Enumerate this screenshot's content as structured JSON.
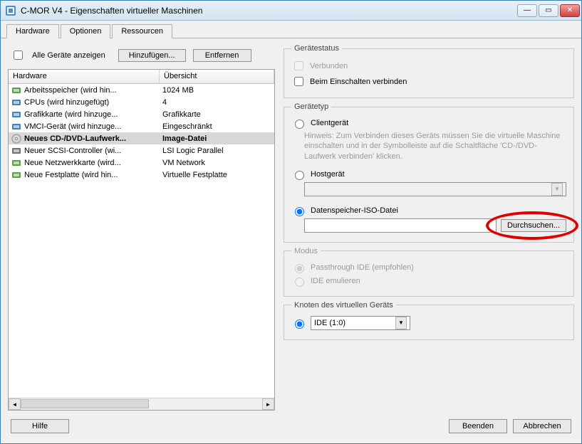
{
  "window": {
    "title": "C-MOR V4 - Eigenschaften virtueller Maschinen"
  },
  "tabs": {
    "hardware": "Hardware",
    "options": "Optionen",
    "resources": "Ressourcen"
  },
  "toprow": {
    "show_all": "Alle Geräte anzeigen",
    "add": "Hinzufügen...",
    "remove": "Entfernen"
  },
  "listhead": {
    "col1": "Hardware",
    "col2": "Übersicht"
  },
  "rows": [
    {
      "name": "Arbeitsspeicher (wird hin...",
      "ov": "1024 MB",
      "icon": "ram"
    },
    {
      "name": "CPUs (wird hinzugefügt)",
      "ov": "4",
      "icon": "cpu"
    },
    {
      "name": "Grafikkarte  (wird hinzuge...",
      "ov": "Grafikkarte",
      "icon": "gpu"
    },
    {
      "name": "VMCI-Gerät (wird hinzuge...",
      "ov": "Eingeschränkt",
      "icon": "vmcidev"
    },
    {
      "name": "Neues CD-/DVD-Laufwerk...",
      "ov": "Image-Datei",
      "icon": "cd",
      "selected": true
    },
    {
      "name": "Neuer SCSI-Controller (wi...",
      "ov": "LSI Logic Parallel",
      "icon": "scsi"
    },
    {
      "name": "Neue Netzwerkkarte (wird...",
      "ov": "VM Network",
      "icon": "nic"
    },
    {
      "name": "Neue Festplatte (wird hin...",
      "ov": "Virtuelle Festplatte",
      "icon": "hdd"
    }
  ],
  "status": {
    "legend": "Gerätestatus",
    "connected": "Verbunden",
    "power_on": "Beim Einschalten verbinden"
  },
  "devtype": {
    "legend": "Gerätetyp",
    "client": "Clientgerät",
    "hint": "Hinweis: Zum Verbinden dieses Geräts müssen Sie die virtuelle Maschine einschalten und in der Symbolleiste auf die Schaltfläche 'CD-/DVD-Laufwerk verbinden' klicken.",
    "host": "Hostgerät",
    "iso": "Datenspeicher-ISO-Datei",
    "browse": "Durchsuchen..."
  },
  "mode": {
    "legend": "Modus",
    "passthrough": "Passthrough IDE (empfohlen)",
    "emulate": "IDE emulieren"
  },
  "node": {
    "legend": "Knoten des virtuellen Geräts",
    "value": "IDE (1:0)"
  },
  "footer": {
    "help": "Hilfe",
    "finish": "Beenden",
    "cancel": "Abbrechen"
  }
}
